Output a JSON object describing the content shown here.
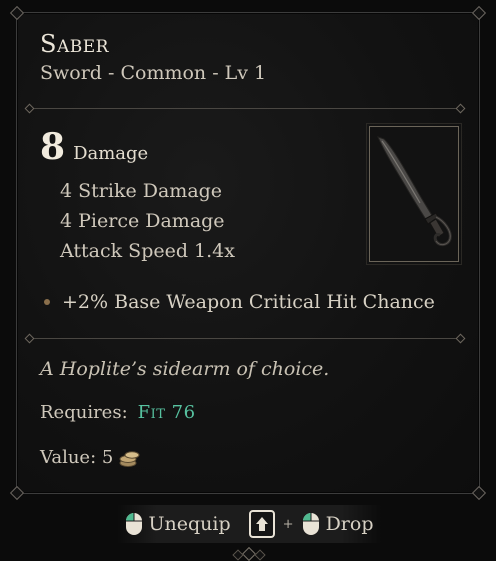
{
  "item": {
    "name": "Saber",
    "subtitle": "Sword - Common - Lv 1",
    "damage_value": "8",
    "damage_label": "Damage",
    "stats": [
      "4 Strike Damage",
      "4 Pierce Damage",
      "Attack Speed 1.4x"
    ],
    "bonus": "+2% Base Weapon Critical Hit Chance",
    "flavor": "A Hoplite’s sidearm of choice.",
    "requires_label": "Requires:",
    "requires_value": "Fit 76",
    "value_label": "Value: 5",
    "icon": "saber-sword-icon"
  },
  "actions": {
    "unequip_label": "Unequip",
    "plus": "+",
    "drop_label": "Drop",
    "unequip_icon": "mouse-left-click-icon",
    "shift_icon": "shift-key-icon",
    "drop_icon": "mouse-left-click-icon"
  },
  "colors": {
    "requirement": "#57c2a0",
    "text": "#d7d1c4",
    "background": "#121212"
  }
}
